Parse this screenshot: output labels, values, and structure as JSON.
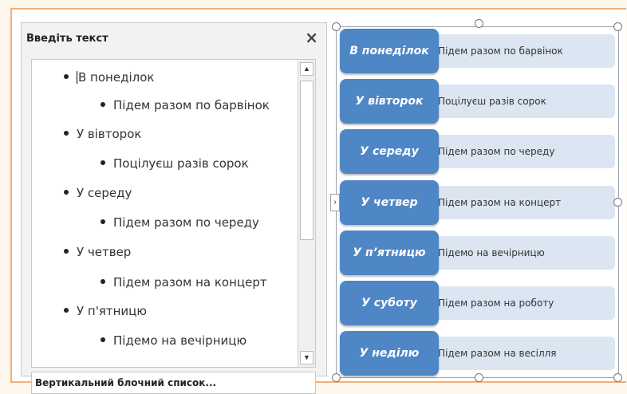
{
  "text_pane": {
    "title": "Введіть текст",
    "close_label": "×",
    "items": [
      {
        "text": "В понеділок",
        "level": 1
      },
      {
        "text": "Підем разом по барвінок",
        "level": 2
      },
      {
        "text": "У вівторок",
        "level": 1
      },
      {
        "text": "Поцілуєш разів сорок",
        "level": 2
      },
      {
        "text": "У середу",
        "level": 1
      },
      {
        "text": "Підем разом по череду",
        "level": 2
      },
      {
        "text": "У четвер",
        "level": 1
      },
      {
        "text": "Підем разом на концерт",
        "level": 2
      },
      {
        "text": "У п'ятницю",
        "level": 1
      },
      {
        "text": "Підемо на вечірницю",
        "level": 2
      }
    ],
    "scroll_up": "▲",
    "scroll_down": "▼",
    "footer": "Вертикальний блочний список..."
  },
  "smartart": {
    "colors": {
      "day_fill": "#4f86c6",
      "detail_fill": "#dce6f2"
    },
    "expand_icon": "›",
    "rows": [
      {
        "day": "В понеділок",
        "detail": "•Підем разом по барвінок"
      },
      {
        "day": "У вівторок",
        "detail": "•Поцілуєш разів сорок"
      },
      {
        "day": "У середу",
        "detail": "•Підем разом по череду"
      },
      {
        "day": "У четвер",
        "detail": "•Підем разом на концерт"
      },
      {
        "day": "У п’ятницю",
        "detail": "•Підемо на вечірницю"
      },
      {
        "day": "У суботу",
        "detail": "•Підем разом на роботу"
      },
      {
        "day": "У неділю",
        "detail": "•Підем разом на весілля"
      }
    ]
  }
}
